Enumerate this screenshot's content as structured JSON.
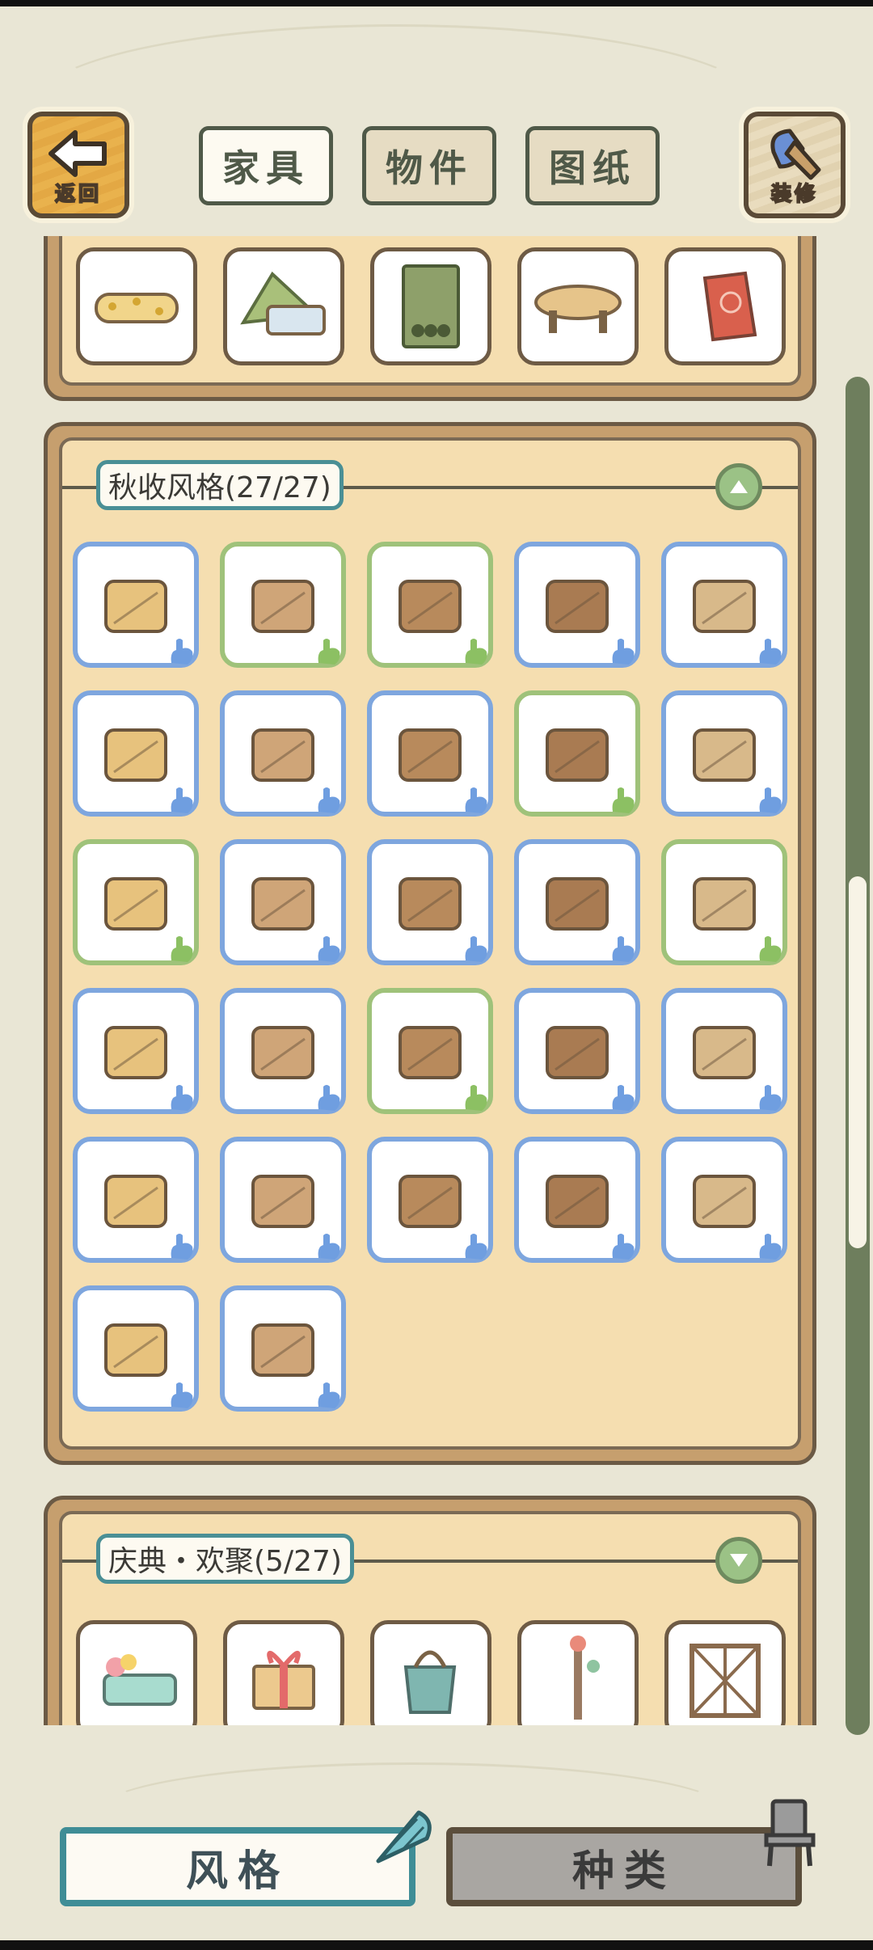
{
  "header": {
    "back_label": "返回",
    "decorate_label": "装修",
    "tabs": [
      {
        "label": "家具",
        "active": true
      },
      {
        "label": "物件",
        "active": false
      },
      {
        "label": "图纸",
        "active": false
      }
    ]
  },
  "sections": {
    "top_partial": {
      "items": [
        {
          "icon": "rolled-mat-icon"
        },
        {
          "icon": "tent-bed-icon"
        },
        {
          "icon": "cabinet-icon"
        },
        {
          "icon": "octagon-table-icon"
        },
        {
          "icon": "deck-chair-icon"
        }
      ]
    },
    "autumn": {
      "label": "秋收风格(27/27)",
      "collapse_icon": "chevron-up-icon",
      "items": [
        {
          "icon": "wallpaper-icon",
          "frame": "blue"
        },
        {
          "icon": "floor-icon",
          "frame": "green"
        },
        {
          "icon": "log-ladder-icon",
          "frame": "green"
        },
        {
          "icon": "log-bench-icon",
          "frame": "blue"
        },
        {
          "icon": "scroll-hanger-icon",
          "frame": "blue"
        },
        {
          "icon": "window-curtain-icon",
          "frame": "blue"
        },
        {
          "icon": "vine-garland-icon",
          "frame": "blue"
        },
        {
          "icon": "rolled-rug-icon",
          "frame": "blue"
        },
        {
          "icon": "straw-bed-icon",
          "frame": "green"
        },
        {
          "icon": "stool-icon",
          "frame": "blue"
        },
        {
          "icon": "hanging-signs-icon",
          "frame": "green"
        },
        {
          "icon": "low-table-icon",
          "frame": "blue"
        },
        {
          "icon": "round-cushion-icon",
          "frame": "blue"
        },
        {
          "icon": "cupboard-icon",
          "frame": "blue"
        },
        {
          "icon": "pampas-vase-icon",
          "frame": "green"
        },
        {
          "icon": "harvest-cart-icon",
          "frame": "blue"
        },
        {
          "icon": "leaf-table-icon",
          "frame": "blue"
        },
        {
          "icon": "wood-chair-icon",
          "frame": "green"
        },
        {
          "icon": "straw-mat-icon",
          "frame": "blue"
        },
        {
          "icon": "stove-counter-icon",
          "frame": "blue"
        },
        {
          "icon": "clay-jar-icon",
          "frame": "blue"
        },
        {
          "icon": "mirror-stand-icon",
          "frame": "blue"
        },
        {
          "icon": "coat-post-icon",
          "frame": "blue"
        },
        {
          "icon": "drying-rack-icon",
          "frame": "blue"
        },
        {
          "icon": "straw-hat-icon",
          "frame": "blue"
        },
        {
          "icon": "thatched-shelf-icon",
          "frame": "blue"
        },
        {
          "icon": "pumpkins-icon",
          "frame": "blue"
        }
      ]
    },
    "festival": {
      "label": "庆典・欢聚(5/27)",
      "collapse_icon": "chevron-down-icon",
      "items": [
        {
          "icon": "flower-bed-icon"
        },
        {
          "icon": "gift-box-icon"
        },
        {
          "icon": "watering-bucket-icon"
        },
        {
          "icon": "coat-rack-icon"
        },
        {
          "icon": "lattice-screen-icon"
        }
      ]
    }
  },
  "footer": {
    "style_label": "风格",
    "type_label": "种类"
  },
  "colors": {
    "background": "#e9e6d5",
    "panel_fill": "#f5deb0",
    "blue_frame": "#7ea6de",
    "green_frame": "#9fc27a",
    "accent_teal": "#3f8d96"
  }
}
